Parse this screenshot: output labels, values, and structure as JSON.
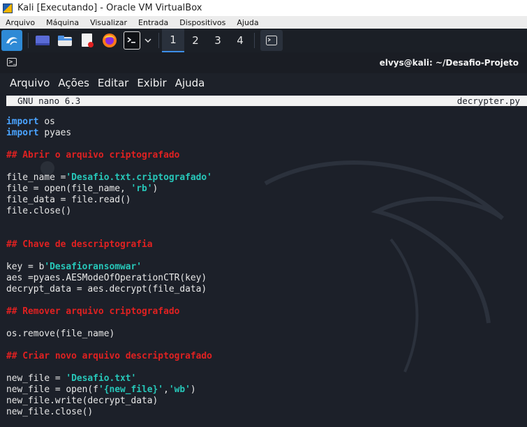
{
  "host_window": {
    "title": "Kali [Executando] - Oracle VM VirtualBox",
    "menu": [
      "Arquivo",
      "Máquina",
      "Visualizar",
      "Entrada",
      "Dispositivos",
      "Ajuda"
    ]
  },
  "panel": {
    "workspaces": [
      "1",
      "2",
      "3",
      "4"
    ],
    "active_workspace": "1"
  },
  "terminal": {
    "title": "elvys@kali: ~/Desafio-Projeto",
    "menu": [
      "Arquivo",
      "Ações",
      "Editar",
      "Exibir",
      "Ajuda"
    ]
  },
  "nano": {
    "version_label": "GNU nano 6.3",
    "filename": "decrypter.py"
  },
  "code_lines": [
    [
      {
        "t": "kw",
        "v": "import"
      },
      {
        "t": "n",
        "v": " os"
      }
    ],
    [
      {
        "t": "kw",
        "v": "import"
      },
      {
        "t": "n",
        "v": " pyaes"
      }
    ],
    [],
    [
      {
        "t": "cm",
        "v": "## Abrir o arquivo criptografado"
      }
    ],
    [],
    [
      {
        "t": "n",
        "v": "file_name ="
      },
      {
        "t": "str",
        "v": "'Desafio.txt.criptografado'"
      }
    ],
    [
      {
        "t": "n",
        "v": "file = open(file_name, "
      },
      {
        "t": "str",
        "v": "'rb'"
      },
      {
        "t": "n",
        "v": ")"
      }
    ],
    [
      {
        "t": "n",
        "v": "file_data = file.read()"
      }
    ],
    [
      {
        "t": "n",
        "v": "file.close()"
      }
    ],
    [],
    [],
    [
      {
        "t": "cm",
        "v": "## Chave de descriptografia"
      }
    ],
    [],
    [
      {
        "t": "n",
        "v": "key = b"
      },
      {
        "t": "str",
        "v": "'Desafioransomwar'"
      }
    ],
    [
      {
        "t": "n",
        "v": "aes =pyaes.AESModeOfOperationCTR(key)"
      }
    ],
    [
      {
        "t": "n",
        "v": "decrypt_data = aes.decrypt(file_data)"
      }
    ],
    [],
    [
      {
        "t": "cm",
        "v": "## Remover arquivo criptografado"
      }
    ],
    [],
    [
      {
        "t": "n",
        "v": "os.remove(file_name)"
      }
    ],
    [],
    [
      {
        "t": "cm",
        "v": "## Criar novo arquivo descriptografado"
      }
    ],
    [],
    [
      {
        "t": "n",
        "v": "new_file = "
      },
      {
        "t": "str",
        "v": "'Desafio.txt'"
      }
    ],
    [
      {
        "t": "n",
        "v": "new_file = open(f"
      },
      {
        "t": "str",
        "v": "'{new_file}'"
      },
      {
        "t": "n",
        "v": ","
      },
      {
        "t": "str",
        "v": "'wb'"
      },
      {
        "t": "n",
        "v": ")"
      }
    ],
    [
      {
        "t": "n",
        "v": "new_file.write(decrypt_data)"
      }
    ],
    [
      {
        "t": "n",
        "v": "new_file.close()"
      }
    ]
  ],
  "colors": {
    "keyword": "#4aa3ff",
    "comment": "#e02121",
    "string": "#27c7b9",
    "background": "#1c2029"
  }
}
